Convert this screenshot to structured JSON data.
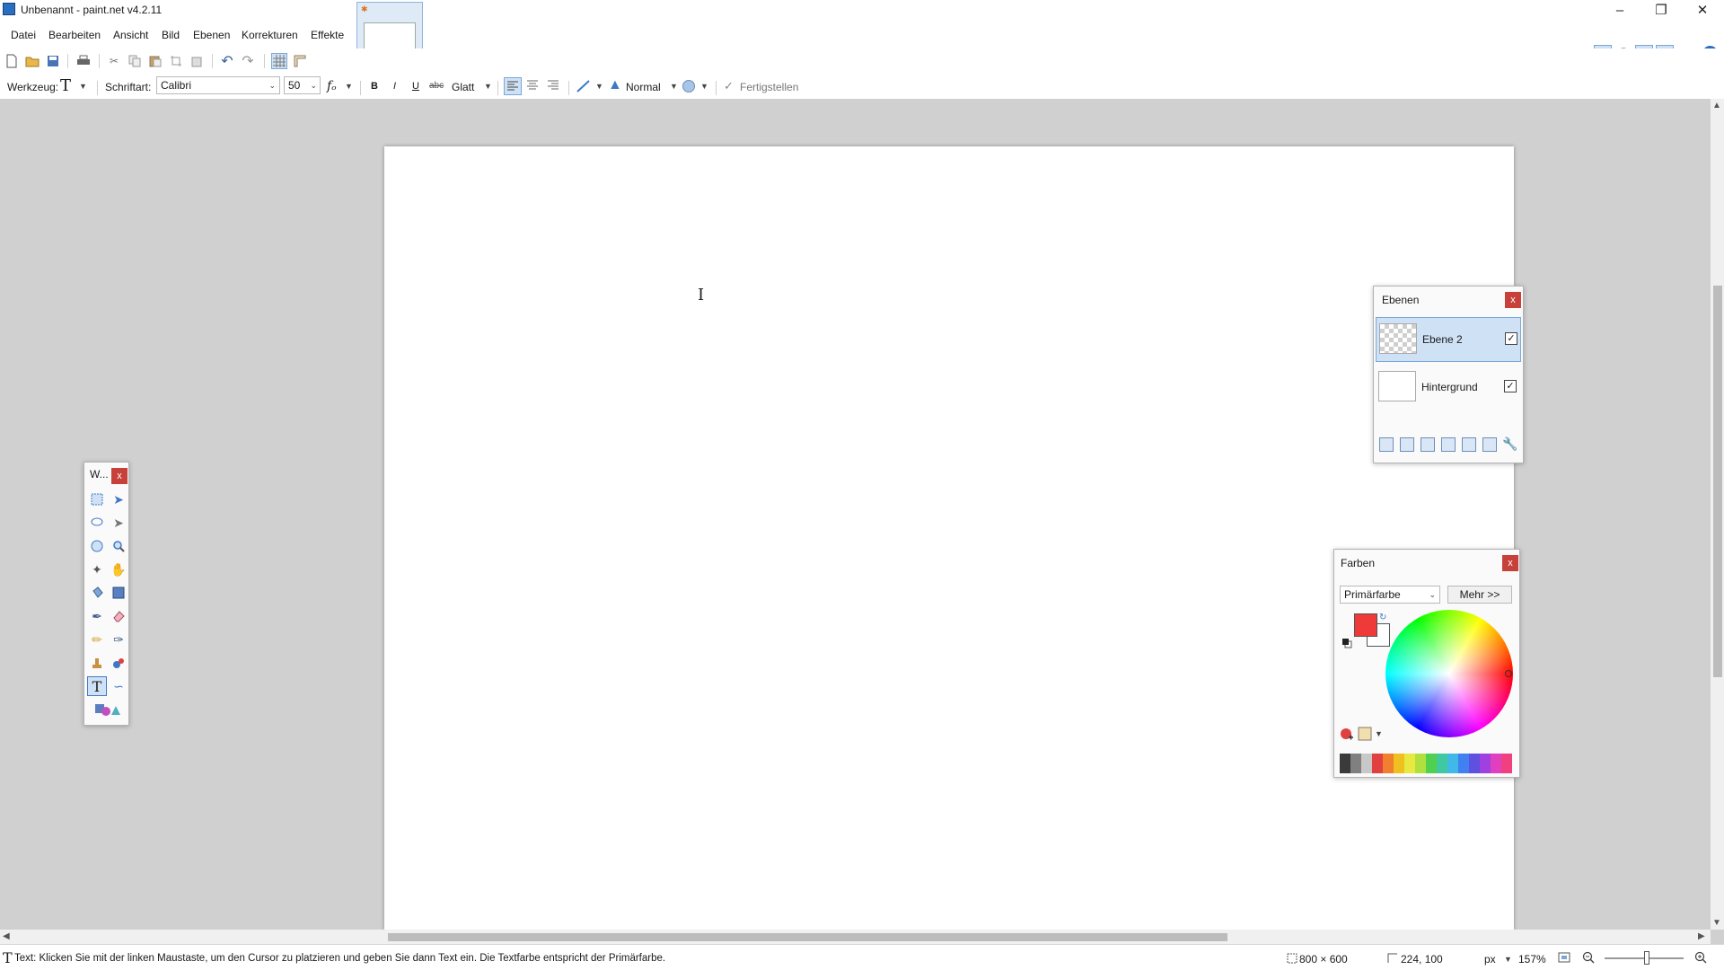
{
  "window": {
    "title": "Unbenannt - paint.net v4.2.11"
  },
  "menu": [
    "Datei",
    "Bearbeiten",
    "Ansicht",
    "Bild",
    "Ebenen",
    "Korrekturen",
    "Effekte"
  ],
  "toolbar2": {
    "tool_label": "Werkzeug:",
    "tool_icon": "T",
    "font_label": "Schriftart:",
    "font_value": "Calibri",
    "size_value": "50",
    "bold": "B",
    "italic": "I",
    "underline": "U",
    "strike": "abc",
    "antialias": "Glatt",
    "blend_mode": "Normal",
    "finish": "Fertigstellen"
  },
  "tools_window": {
    "title": "W...",
    "close": "x"
  },
  "layers_window": {
    "title": "Ebenen",
    "close": "x",
    "layers": [
      {
        "name": "Ebene 2",
        "visible": true,
        "selected": true
      },
      {
        "name": "Hintergrund",
        "visible": true,
        "selected": false
      }
    ]
  },
  "colors_window": {
    "title": "Farben",
    "close": "x",
    "mode": "Primärfarbe",
    "more_button": "Mehr >>",
    "primary_color": "#f03a3a",
    "secondary_color": "#ffffff",
    "palette": [
      "#3a3a3a",
      "#808080",
      "#c8c8c8",
      "#e24040",
      "#f08030",
      "#f0c020",
      "#e8e840",
      "#b0e040",
      "#50d050",
      "#40c8a0",
      "#40b8e8",
      "#4080f0",
      "#6050e0",
      "#a040e0",
      "#e040c0",
      "#f04080"
    ]
  },
  "status": {
    "message": "Text: Klicken Sie mit der linken Maustaste, um den Cursor zu platzieren und geben Sie dann Text ein. Die Textfarbe entspricht der Primärfarbe.",
    "image_size": "800 × 600",
    "cursor_pos": "224, 100",
    "unit": "px",
    "zoom": "157%"
  },
  "colors": {
    "accent": "#3f78c8",
    "close": "#c8403a"
  }
}
